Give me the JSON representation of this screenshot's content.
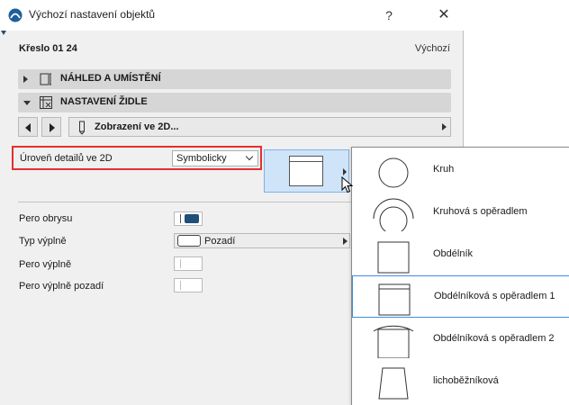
{
  "window": {
    "title": "Výchozí nastavení objektů",
    "help": "?",
    "close": "✕"
  },
  "object": {
    "name": "Křeslo 01 24",
    "default_label": "Výchozí"
  },
  "sections": [
    {
      "label": "NÁHLED A UMÍSTĚNÍ",
      "expanded": false
    },
    {
      "label": "NASTAVENÍ ŽIDLE",
      "expanded": true
    }
  ],
  "nav": {
    "field_label": "Zobrazení ve 2D..."
  },
  "detail": {
    "label": "Úroveň detailů ve 2D",
    "value": "Symbolicky"
  },
  "properties": {
    "outline_pen": {
      "label": "Pero obrysu",
      "color": "#1f4e79"
    },
    "fill_type": {
      "label": "Typ výplně",
      "value": "Pozadí"
    },
    "fill_pen": {
      "label": "Pero výplně"
    },
    "fill_bg_pen": {
      "label": "Pero výplně pozadí"
    }
  },
  "popup": {
    "items": [
      {
        "label": "Kruh",
        "icon": "circle-icon"
      },
      {
        "label": "Kruhová s opěradlem",
        "icon": "circle-backrest-icon"
      },
      {
        "label": "Obdélník",
        "icon": "rectangle-icon"
      },
      {
        "label": "Obdélníková s opěradlem 1",
        "icon": "rectangle-backrest-1-icon",
        "selected": true
      },
      {
        "label": "Obdélníková s opěradlem 2",
        "icon": "rectangle-backrest-2-icon"
      },
      {
        "label": "lichoběžníková",
        "icon": "trapezoid-icon"
      }
    ]
  },
  "colors": {
    "highlight_border": "#e23030",
    "selection_blue": "#3e8ede",
    "preview_bg": "#cfe4f9"
  }
}
